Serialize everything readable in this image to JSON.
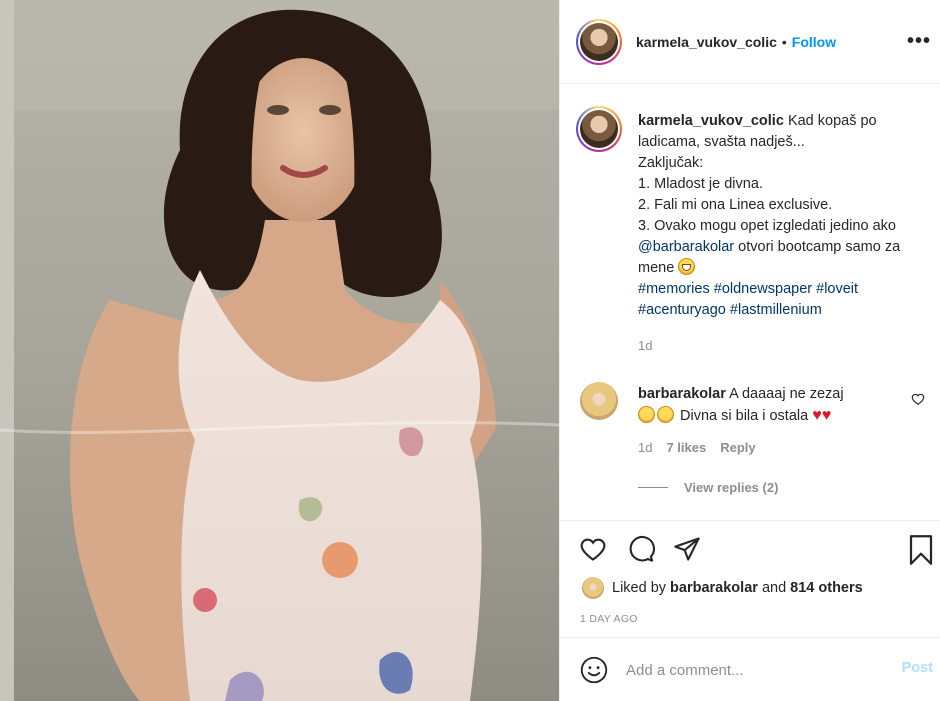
{
  "post": {
    "header": {
      "username": "karmela_vukov_colic",
      "separator": "•",
      "follow_label": "Follow",
      "more_label": "•••"
    },
    "caption": {
      "username": "karmela_vukov_colic",
      "lines": [
        "Kad kopaš po ladicama, svašta nadješ...",
        "Zaključak:",
        "1. Mladost je divna.",
        "2. Fali mi ona Linea exclusive.",
        "3. Ovako mogu opet izgledati jedino ako",
        "@barbarakolar",
        "otvori bootcamp samo za mene",
        "#memories",
        "#oldnewspaper",
        "#loveit",
        "#acenturyago",
        "#lastmillenium"
      ],
      "time": "1d"
    },
    "comment": {
      "username": "barbarakolar",
      "text_line1": "A daaaaj ne zezaj",
      "text_line2": "Divna si bila i ostala",
      "time": "1d",
      "likes": "7 likes",
      "reply_label": "Reply",
      "view_replies": "View replies (2)"
    },
    "likes": {
      "prefix": "Liked by",
      "user": "barbarakolar",
      "middle": "and",
      "others": "814 others"
    },
    "posted_ago": "1 DAY AGO",
    "add_comment": {
      "placeholder": "Add a comment...",
      "post_label": "Post"
    },
    "icons": {
      "like": "heart-icon",
      "comment": "comment-icon",
      "share": "share-icon",
      "save": "bookmark-icon",
      "emoji": "emoji-icon"
    },
    "colors": {
      "follow": "#0095f6",
      "link": "#00376b",
      "muted": "#8e8e8e",
      "post_disabled": "#b2dffc",
      "heart": "#e0162b"
    }
  }
}
